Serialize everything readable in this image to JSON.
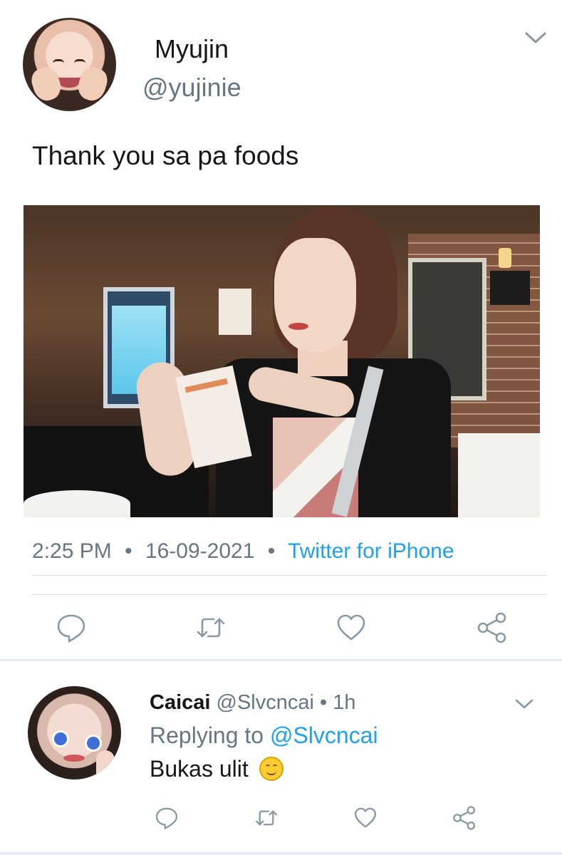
{
  "tweet": {
    "display_name": "Myujin",
    "handle": "@yujinie",
    "text": "Thank you sa pa foods",
    "time": "2:25 PM",
    "date": "16-09-2021",
    "source": "Twitter for iPhone",
    "separator": "•"
  },
  "reply": {
    "display_name": "Caicai",
    "handle": "@Slvcncai",
    "separator": "•",
    "time": "1h",
    "replying_prefix": "Replying to",
    "replying_to": "@Slvcncai",
    "text": "Bukas ulit"
  },
  "colors": {
    "accent": "#1da1f2",
    "secondary_text": "#657786",
    "primary_text": "#14171a",
    "icon": "#8899a6"
  },
  "icons": {
    "reply": "reply-icon",
    "retweet": "retweet-icon",
    "like": "heart-icon",
    "share": "share-icon",
    "menu": "chevron-down-icon"
  }
}
